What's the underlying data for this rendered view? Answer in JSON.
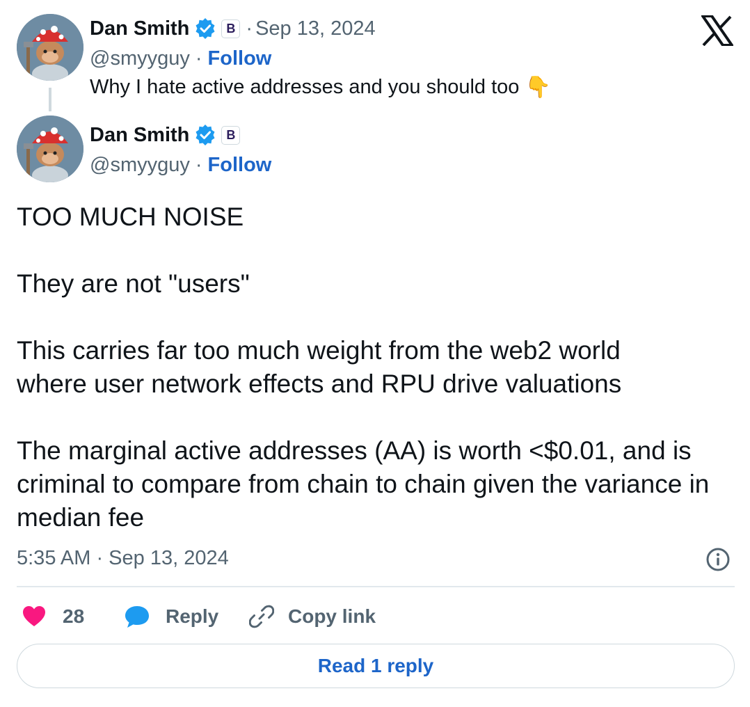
{
  "quoted_tweet": {
    "author_name": "Dan Smith",
    "badge_letter": "B",
    "date": "Sep 13, 2024",
    "handle": "@smyyguy",
    "follow_label": "Follow",
    "text": "Why I hate active addresses and you should too",
    "emoji": "👇"
  },
  "tweet": {
    "author_name": "Dan Smith",
    "badge_letter": "B",
    "handle": "@smyyguy",
    "follow_label": "Follow",
    "paragraphs": [
      "TOO MUCH NOISE",
      "They are not \"users\"",
      "This carries far too much weight from the web2 world where user network effects and RPU drive valuations",
      "The marginal active addresses (AA) is worth <$0.01, and is criminal to compare from chain to chain given the variance in median fee"
    ],
    "timestamp": "5:35 AM · Sep 13, 2024"
  },
  "actions": {
    "like_count": "28",
    "reply_label": "Reply",
    "copy_label": "Copy link"
  },
  "read_replies_label": "Read 1 reply",
  "colors": {
    "verified": "#1d9bf0",
    "like": "#f91880",
    "link": "#1d65c9",
    "reply_bubble": "#1d9bf0"
  },
  "icons": {
    "brand": "x-logo-icon",
    "verified": "verified-badge-icon",
    "info": "info-icon",
    "like": "heart-icon",
    "reply": "speech-bubble-icon",
    "copy": "link-icon"
  }
}
